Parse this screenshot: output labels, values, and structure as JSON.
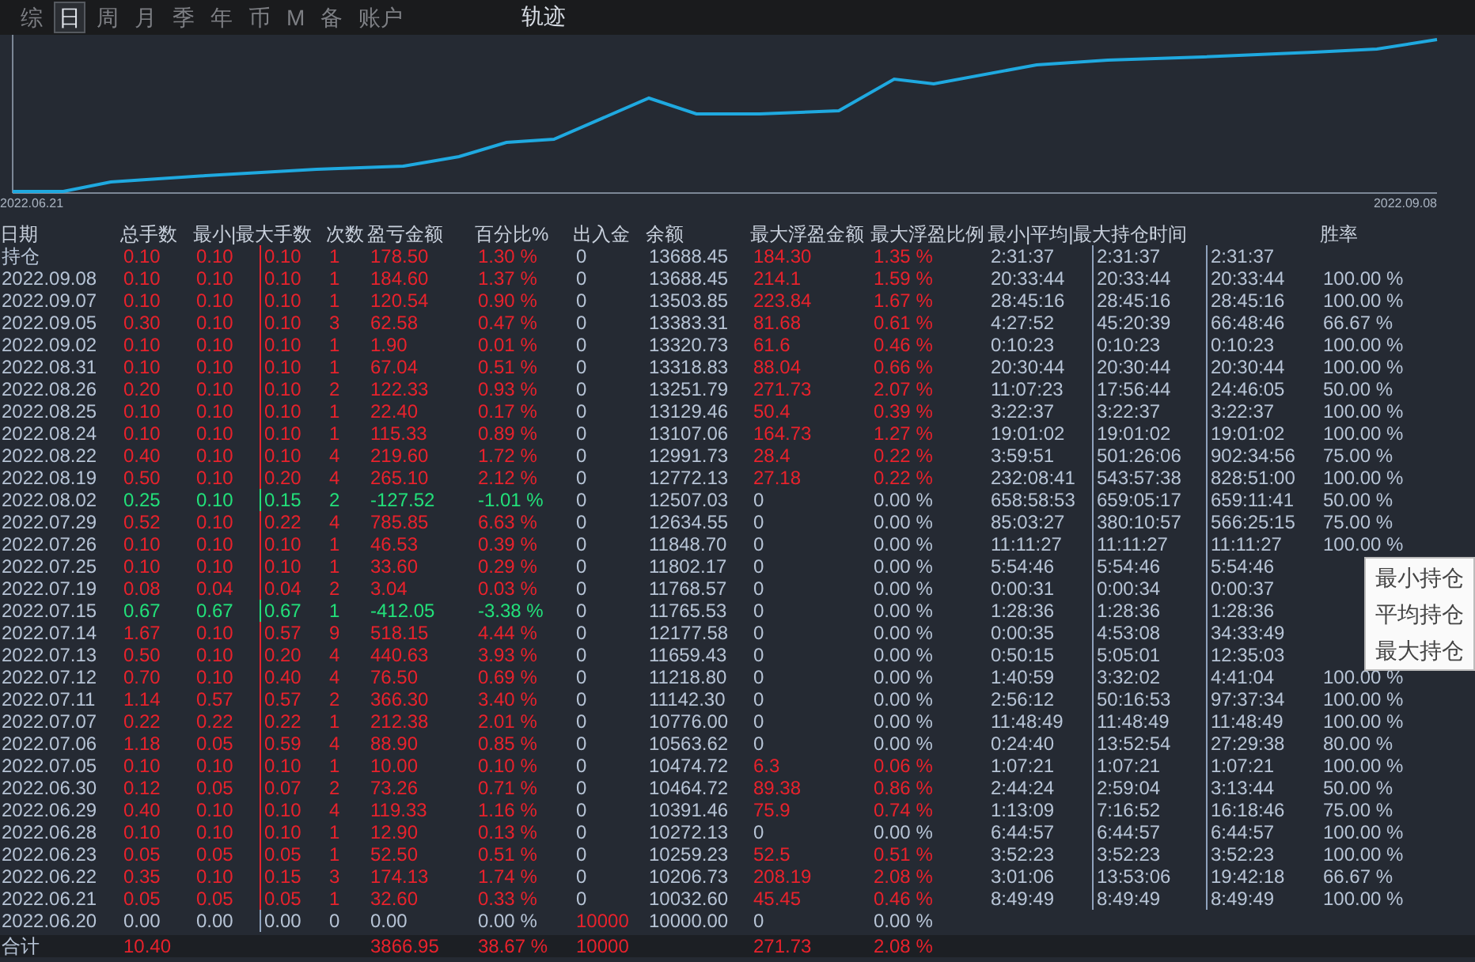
{
  "tabs": [
    {
      "label": "综",
      "selected": false
    },
    {
      "label": "日",
      "selected": true
    },
    {
      "label": "周",
      "selected": false
    },
    {
      "label": "月",
      "selected": false
    },
    {
      "label": "季",
      "selected": false
    },
    {
      "label": "年",
      "selected": false
    },
    {
      "label": "币",
      "selected": false
    },
    {
      "label": "M",
      "selected": false
    },
    {
      "label": "备",
      "selected": false
    },
    {
      "label": "账户",
      "selected": false
    }
  ],
  "chart": {
    "title": "轨迹",
    "start_label": "2022.06.21",
    "end_label": "2022.09.08"
  },
  "table": {
    "columns": [
      "日期",
      "总手数",
      "最小|最大手数",
      "次数",
      "盈亏金额",
      "百分比%",
      "出入金",
      "余额",
      "最大浮盈金额",
      "最大浮盈比例",
      "最小|平均|最大持仓时间",
      "胜率"
    ],
    "rows": [
      {
        "date": "持仓",
        "traded": true,
        "loss": false,
        "float_hit": true,
        "deposit_hit": false,
        "total": "0.10",
        "min": "0.10",
        "max": "0.10",
        "count": "1",
        "pnl": "178.50",
        "pct": "1.30 %",
        "deposit": "0",
        "balance": "13688.45",
        "max_float": "184.30",
        "float_pct": "1.35 %",
        "times": [
          "2:31:37",
          "2:31:37",
          "2:31:37"
        ]
      },
      {
        "date": "2022.09.08",
        "traded": true,
        "loss": false,
        "float_hit": true,
        "deposit_hit": false,
        "total": "0.10",
        "min": "0.10",
        "max": "0.10",
        "count": "1",
        "pnl": "184.60",
        "pct": "1.37 %",
        "deposit": "0",
        "balance": "13688.45",
        "max_float": "214.1",
        "float_pct": "1.59 %",
        "times": [
          "20:33:44",
          "20:33:44",
          "20:33:44"
        ],
        "win_rate": "100.00 %"
      },
      {
        "date": "2022.09.07",
        "traded": true,
        "loss": false,
        "float_hit": true,
        "deposit_hit": false,
        "total": "0.10",
        "min": "0.10",
        "max": "0.10",
        "count": "1",
        "pnl": "120.54",
        "pct": "0.90 %",
        "deposit": "0",
        "balance": "13503.85",
        "max_float": "223.84",
        "float_pct": "1.67 %",
        "times": [
          "28:45:16",
          "28:45:16",
          "28:45:16"
        ],
        "win_rate": "100.00 %"
      },
      {
        "date": "2022.09.05",
        "traded": true,
        "loss": false,
        "float_hit": true,
        "deposit_hit": false,
        "total": "0.30",
        "min": "0.10",
        "max": "0.10",
        "count": "3",
        "pnl": "62.58",
        "pct": "0.47 %",
        "deposit": "0",
        "balance": "13383.31",
        "max_float": "81.68",
        "float_pct": "0.61 %",
        "times": [
          "4:27:52",
          "45:20:39",
          "66:48:46"
        ],
        "win_rate": "66.67 %"
      },
      {
        "date": "2022.09.02",
        "traded": true,
        "loss": false,
        "float_hit": true,
        "deposit_hit": false,
        "total": "0.10",
        "min": "0.10",
        "max": "0.10",
        "count": "1",
        "pnl": "1.90",
        "pct": "0.01 %",
        "deposit": "0",
        "balance": "13320.73",
        "max_float": "61.6",
        "float_pct": "0.46 %",
        "times": [
          "0:10:23",
          "0:10:23",
          "0:10:23"
        ],
        "win_rate": "100.00 %"
      },
      {
        "date": "2022.08.31",
        "traded": true,
        "loss": false,
        "float_hit": true,
        "deposit_hit": false,
        "total": "0.10",
        "min": "0.10",
        "max": "0.10",
        "count": "1",
        "pnl": "67.04",
        "pct": "0.51 %",
        "deposit": "0",
        "balance": "13318.83",
        "max_float": "88.04",
        "float_pct": "0.66 %",
        "times": [
          "20:30:44",
          "20:30:44",
          "20:30:44"
        ],
        "win_rate": "100.00 %"
      },
      {
        "date": "2022.08.26",
        "traded": true,
        "loss": false,
        "float_hit": true,
        "deposit_hit": false,
        "total": "0.20",
        "min": "0.10",
        "max": "0.10",
        "count": "2",
        "pnl": "122.33",
        "pct": "0.93 %",
        "deposit": "0",
        "balance": "13251.79",
        "max_float": "271.73",
        "float_pct": "2.07 %",
        "times": [
          "11:07:23",
          "17:56:44",
          "24:46:05"
        ],
        "win_rate": "50.00 %"
      },
      {
        "date": "2022.08.25",
        "traded": true,
        "loss": false,
        "float_hit": true,
        "deposit_hit": false,
        "total": "0.10",
        "min": "0.10",
        "max": "0.10",
        "count": "1",
        "pnl": "22.40",
        "pct": "0.17 %",
        "deposit": "0",
        "balance": "13129.46",
        "max_float": "50.4",
        "float_pct": "0.39 %",
        "times": [
          "3:22:37",
          "3:22:37",
          "3:22:37"
        ],
        "win_rate": "100.00 %"
      },
      {
        "date": "2022.08.24",
        "traded": true,
        "loss": false,
        "float_hit": true,
        "deposit_hit": false,
        "total": "0.10",
        "min": "0.10",
        "max": "0.10",
        "count": "1",
        "pnl": "115.33",
        "pct": "0.89 %",
        "deposit": "0",
        "balance": "13107.06",
        "max_float": "164.73",
        "float_pct": "1.27 %",
        "times": [
          "19:01:02",
          "19:01:02",
          "19:01:02"
        ],
        "win_rate": "100.00 %"
      },
      {
        "date": "2022.08.22",
        "traded": true,
        "loss": false,
        "float_hit": true,
        "deposit_hit": false,
        "total": "0.40",
        "min": "0.10",
        "max": "0.10",
        "count": "4",
        "pnl": "219.60",
        "pct": "1.72 %",
        "deposit": "0",
        "balance": "12991.73",
        "max_float": "28.4",
        "float_pct": "0.22 %",
        "times": [
          "3:59:51",
          "501:26:06",
          "902:34:56"
        ],
        "win_rate": "75.00 %"
      },
      {
        "date": "2022.08.19",
        "traded": true,
        "loss": false,
        "float_hit": true,
        "deposit_hit": false,
        "total": "0.50",
        "min": "0.10",
        "max": "0.20",
        "count": "4",
        "pnl": "265.10",
        "pct": "2.12 %",
        "deposit": "0",
        "balance": "12772.13",
        "max_float": "27.18",
        "float_pct": "0.22 %",
        "times": [
          "232:08:41",
          "543:57:38",
          "828:51:00"
        ],
        "win_rate": "100.00 %"
      },
      {
        "date": "2022.08.02",
        "traded": true,
        "loss": true,
        "float_hit": false,
        "deposit_hit": false,
        "total": "0.25",
        "min": "0.10",
        "max": "0.15",
        "count": "2",
        "pnl": "-127.52",
        "pct": "-1.01 %",
        "deposit": "0",
        "balance": "12507.03",
        "max_float": "0",
        "float_pct": "0.00 %",
        "times": [
          "658:58:53",
          "659:05:17",
          "659:11:41"
        ],
        "win_rate": "50.00 %"
      },
      {
        "date": "2022.07.29",
        "traded": true,
        "loss": false,
        "float_hit": false,
        "deposit_hit": false,
        "total": "0.52",
        "min": "0.10",
        "max": "0.22",
        "count": "4",
        "pnl": "785.85",
        "pct": "6.63 %",
        "deposit": "0",
        "balance": "12634.55",
        "max_float": "0",
        "float_pct": "0.00 %",
        "times": [
          "85:03:27",
          "380:10:57",
          "566:25:15"
        ],
        "win_rate": "75.00 %"
      },
      {
        "date": "2022.07.26",
        "traded": true,
        "loss": false,
        "float_hit": false,
        "deposit_hit": false,
        "total": "0.10",
        "min": "0.10",
        "max": "0.10",
        "count": "1",
        "pnl": "46.53",
        "pct": "0.39 %",
        "deposit": "0",
        "balance": "11848.70",
        "max_float": "0",
        "float_pct": "0.00 %",
        "times": [
          "11:11:27",
          "11:11:27",
          "11:11:27"
        ],
        "win_rate": "100.00 %"
      },
      {
        "date": "2022.07.25",
        "traded": true,
        "loss": false,
        "float_hit": false,
        "deposit_hit": false,
        "total": "0.10",
        "min": "0.10",
        "max": "0.10",
        "count": "1",
        "pnl": "33.60",
        "pct": "0.29 %",
        "deposit": "0",
        "balance": "11802.17",
        "max_float": "0",
        "float_pct": "0.00 %",
        "times": [
          "5:54:46",
          "5:54:46",
          "5:54:46"
        ]
      },
      {
        "date": "2022.07.19",
        "traded": true,
        "loss": false,
        "float_hit": false,
        "deposit_hit": false,
        "total": "0.08",
        "min": "0.04",
        "max": "0.04",
        "count": "2",
        "pnl": "3.04",
        "pct": "0.03 %",
        "deposit": "0",
        "balance": "11768.57",
        "max_float": "0",
        "float_pct": "0.00 %",
        "times": [
          "0:00:31",
          "0:00:34",
          "0:00:37"
        ]
      },
      {
        "date": "2022.07.15",
        "traded": true,
        "loss": true,
        "float_hit": false,
        "deposit_hit": false,
        "total": "0.67",
        "min": "0.67",
        "max": "0.67",
        "count": "1",
        "pnl": "-412.05",
        "pct": "-3.38 %",
        "deposit": "0",
        "balance": "11765.53",
        "max_float": "0",
        "float_pct": "0.00 %",
        "times": [
          "1:28:36",
          "1:28:36",
          "1:28:36"
        ]
      },
      {
        "date": "2022.07.14",
        "traded": true,
        "loss": false,
        "float_hit": false,
        "deposit_hit": false,
        "total": "1.67",
        "min": "0.10",
        "max": "0.57",
        "count": "9",
        "pnl": "518.15",
        "pct": "4.44 %",
        "deposit": "0",
        "balance": "12177.58",
        "max_float": "0",
        "float_pct": "0.00 %",
        "times": [
          "0:00:35",
          "4:53:08",
          "34:33:49"
        ]
      },
      {
        "date": "2022.07.13",
        "traded": true,
        "loss": false,
        "float_hit": false,
        "deposit_hit": false,
        "total": "0.50",
        "min": "0.10",
        "max": "0.20",
        "count": "4",
        "pnl": "440.63",
        "pct": "3.93 %",
        "deposit": "0",
        "balance": "11659.43",
        "max_float": "0",
        "float_pct": "0.00 %",
        "times": [
          "0:50:15",
          "5:05:01",
          "12:35:03"
        ]
      },
      {
        "date": "2022.07.12",
        "traded": true,
        "loss": false,
        "float_hit": false,
        "deposit_hit": false,
        "total": "0.70",
        "min": "0.10",
        "max": "0.40",
        "count": "4",
        "pnl": "76.50",
        "pct": "0.69 %",
        "deposit": "0",
        "balance": "11218.80",
        "max_float": "0",
        "float_pct": "0.00 %",
        "times": [
          "1:40:59",
          "3:32:02",
          "4:41:04"
        ],
        "win_rate": "100.00 %"
      },
      {
        "date": "2022.07.11",
        "traded": true,
        "loss": false,
        "float_hit": false,
        "deposit_hit": false,
        "total": "1.14",
        "min": "0.57",
        "max": "0.57",
        "count": "2",
        "pnl": "366.30",
        "pct": "3.40 %",
        "deposit": "0",
        "balance": "11142.30",
        "max_float": "0",
        "float_pct": "0.00 %",
        "times": [
          "2:56:12",
          "50:16:53",
          "97:37:34"
        ],
        "win_rate": "100.00 %"
      },
      {
        "date": "2022.07.07",
        "traded": true,
        "loss": false,
        "float_hit": false,
        "deposit_hit": false,
        "total": "0.22",
        "min": "0.22",
        "max": "0.22",
        "count": "1",
        "pnl": "212.38",
        "pct": "2.01 %",
        "deposit": "0",
        "balance": "10776.00",
        "max_float": "0",
        "float_pct": "0.00 %",
        "times": [
          "11:48:49",
          "11:48:49",
          "11:48:49"
        ],
        "win_rate": "100.00 %"
      },
      {
        "date": "2022.07.06",
        "traded": true,
        "loss": false,
        "float_hit": false,
        "deposit_hit": false,
        "total": "1.18",
        "min": "0.05",
        "max": "0.59",
        "count": "4",
        "pnl": "88.90",
        "pct": "0.85 %",
        "deposit": "0",
        "balance": "10563.62",
        "max_float": "0",
        "float_pct": "0.00 %",
        "times": [
          "0:24:40",
          "13:52:54",
          "27:29:38"
        ],
        "win_rate": "80.00 %"
      },
      {
        "date": "2022.07.05",
        "traded": true,
        "loss": false,
        "float_hit": true,
        "deposit_hit": false,
        "total": "0.10",
        "min": "0.10",
        "max": "0.10",
        "count": "1",
        "pnl": "10.00",
        "pct": "0.10 %",
        "deposit": "0",
        "balance": "10474.72",
        "max_float": "6.3",
        "float_pct": "0.06 %",
        "times": [
          "1:07:21",
          "1:07:21",
          "1:07:21"
        ],
        "win_rate": "100.00 %"
      },
      {
        "date": "2022.06.30",
        "traded": true,
        "loss": false,
        "float_hit": true,
        "deposit_hit": false,
        "total": "0.12",
        "min": "0.05",
        "max": "0.07",
        "count": "2",
        "pnl": "73.26",
        "pct": "0.71 %",
        "deposit": "0",
        "balance": "10464.72",
        "max_float": "89.38",
        "float_pct": "0.86 %",
        "times": [
          "2:44:24",
          "2:59:04",
          "3:13:44"
        ],
        "win_rate": "50.00 %"
      },
      {
        "date": "2022.06.29",
        "traded": true,
        "loss": false,
        "float_hit": true,
        "deposit_hit": false,
        "total": "0.40",
        "min": "0.10",
        "max": "0.10",
        "count": "4",
        "pnl": "119.33",
        "pct": "1.16 %",
        "deposit": "0",
        "balance": "10391.46",
        "max_float": "75.9",
        "float_pct": "0.74 %",
        "times": [
          "1:13:09",
          "7:16:52",
          "16:18:46"
        ],
        "win_rate": "75.00 %"
      },
      {
        "date": "2022.06.28",
        "traded": true,
        "loss": false,
        "float_hit": false,
        "deposit_hit": false,
        "total": "0.10",
        "min": "0.10",
        "max": "0.10",
        "count": "1",
        "pnl": "12.90",
        "pct": "0.13 %",
        "deposit": "0",
        "balance": "10272.13",
        "max_float": "0",
        "float_pct": "0.00 %",
        "times": [
          "6:44:57",
          "6:44:57",
          "6:44:57"
        ],
        "win_rate": "100.00 %"
      },
      {
        "date": "2022.06.23",
        "traded": true,
        "loss": false,
        "float_hit": true,
        "deposit_hit": false,
        "total": "0.05",
        "min": "0.05",
        "max": "0.05",
        "count": "1",
        "pnl": "52.50",
        "pct": "0.51 %",
        "deposit": "0",
        "balance": "10259.23",
        "max_float": "52.5",
        "float_pct": "0.51 %",
        "times": [
          "3:52:23",
          "3:52:23",
          "3:52:23"
        ],
        "win_rate": "100.00 %"
      },
      {
        "date": "2022.06.22",
        "traded": true,
        "loss": false,
        "float_hit": true,
        "deposit_hit": false,
        "total": "0.35",
        "min": "0.10",
        "max": "0.15",
        "count": "3",
        "pnl": "174.13",
        "pct": "1.74 %",
        "deposit": "0",
        "balance": "10206.73",
        "max_float": "208.19",
        "float_pct": "2.08 %",
        "times": [
          "3:01:06",
          "13:53:06",
          "19:42:18"
        ],
        "win_rate": "66.67 %"
      },
      {
        "date": "2022.06.21",
        "traded": true,
        "loss": false,
        "float_hit": true,
        "deposit_hit": false,
        "total": "0.05",
        "min": "0.05",
        "max": "0.05",
        "count": "1",
        "pnl": "32.60",
        "pct": "0.33 %",
        "deposit": "0",
        "balance": "10032.60",
        "max_float": "45.45",
        "float_pct": "0.46 %",
        "times": [
          "8:49:49",
          "8:49:49",
          "8:49:49"
        ],
        "win_rate": "100.00 %"
      },
      {
        "date": "2022.06.20",
        "traded": false,
        "loss": false,
        "float_hit": false,
        "deposit_hit": true,
        "total": "0.00",
        "min": "0.00",
        "max": "0.00",
        "count": "0",
        "pnl": "0.00",
        "pct": "0.00 %",
        "deposit": "10000",
        "balance": "10000.00",
        "max_float": "0",
        "float_pct": "0.00 %"
      }
    ],
    "summary": {
      "label": "合计",
      "total": "10.40",
      "pnl": "3866.95",
      "pct": "38.67 %",
      "deposit": "10000",
      "max_float": "271.73",
      "float_pct": "2.08 %"
    }
  },
  "tooltip": {
    "lines": [
      "最小持仓",
      "平均持仓",
      "最大持仓"
    ]
  }
}
